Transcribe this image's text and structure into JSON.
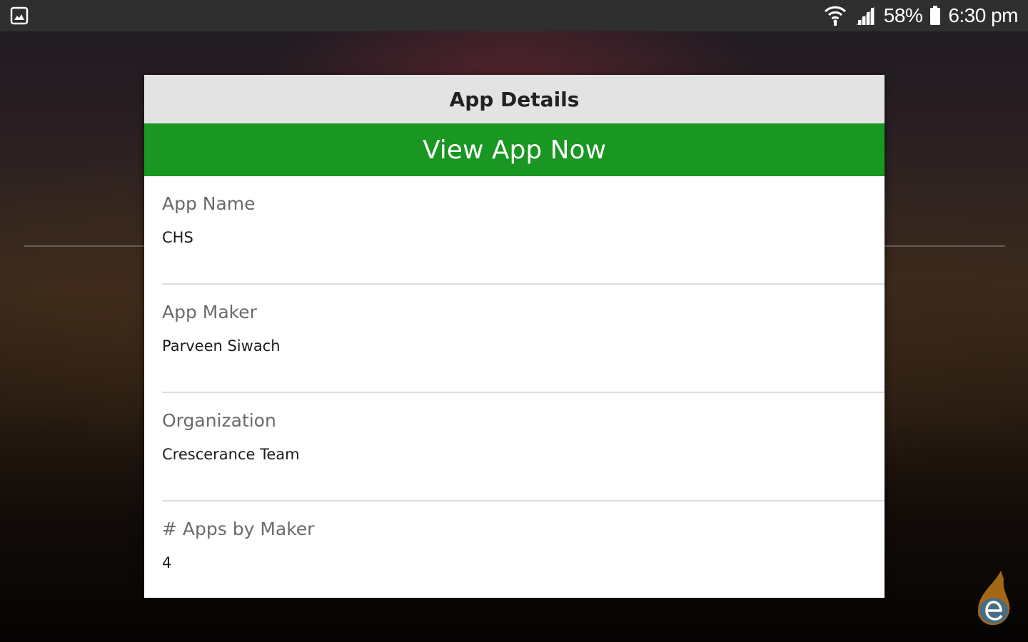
{
  "status_bar": {
    "battery": "58%",
    "time": "6:30 pm",
    "icons": [
      "gallery-icon",
      "wifi-icon",
      "signal-icon",
      "battery-icon"
    ]
  },
  "dialog": {
    "title": "App Details",
    "action_label": "View App Now",
    "action_color": "#1a9622",
    "fields": [
      {
        "label": "App Name",
        "value": "CHS"
      },
      {
        "label": "App Maker",
        "value": "Parveen Siwach"
      },
      {
        "label": "Organization",
        "value": "Crescerance Team"
      },
      {
        "label": "# Apps by Maker",
        "value": "4"
      }
    ]
  },
  "watermark": {
    "icon": "flame-e-logo-icon"
  }
}
